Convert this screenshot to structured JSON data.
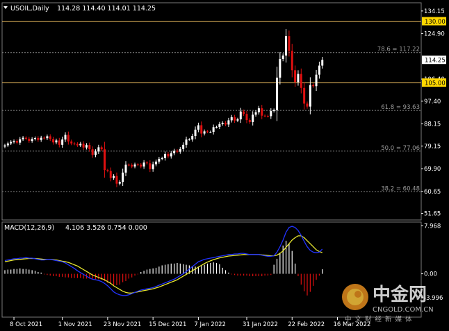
{
  "header": {
    "symbol": "USOIL,Daily",
    "ohlc": "114.28 114.40 114.01 114.25"
  },
  "indicator": {
    "title": "MACD(12,26,9)",
    "values": "4.106 3.526 0.754 0.000"
  },
  "watermark": {
    "brand": "中金网",
    "site": "CNGOLD.COM.CN",
    "tagline": "中文财经新媒体"
  },
  "colors": {
    "background": "#000000",
    "bull_candle": "#ffffff",
    "bear_candle": "#e01010",
    "macd_line": "#2233ff",
    "signal_line": "#e8e830",
    "hist_pos": "#ffffff",
    "hist_neg": "#e01010",
    "level_line": "#f0c060",
    "fib_line": "#8a8a8a",
    "current_price_bg": "#ffffff",
    "level_price_bg": "#ffd700"
  },
  "chart_data": [
    {
      "type": "candlestick",
      "title": "USOIL,Daily",
      "ylim": [
        49.0,
        137.5
      ],
      "yticks": [
        "134.15",
        "124.90",
        "106.40",
        "97.40",
        "88.15",
        "79.15",
        "69.90",
        "60.65",
        "51.65"
      ],
      "x_labels": [
        "8 Oct 2021",
        "1 Nov 2021",
        "23 Nov 2021",
        "15 Dec 2021",
        "7 Jan 2022",
        "31 Jan 2022",
        "22 Feb 2022",
        "16 Mar 2022"
      ],
      "levels": [
        {
          "label": "130.00",
          "value": 130.0
        },
        {
          "label": "105.00",
          "value": 105.0
        }
      ],
      "fib_levels": [
        {
          "label": "78.6 = 117.22",
          "value": 117.22
        },
        {
          "label": "61.8 = 93.63",
          "value": 93.63
        },
        {
          "label": "50.0 = 77.06",
          "value": 77.06
        },
        {
          "label": "38.2 = 60.48",
          "value": 60.48
        }
      ],
      "current_price": {
        "label": "114.25",
        "value": 114.25
      },
      "close": [
        79.4,
        80.2,
        80.8,
        81.2,
        80.5,
        81.9,
        82.5,
        82.1,
        81.2,
        82.0,
        82.4,
        81.6,
        82.5,
        82.3,
        83.1,
        82.0,
        80.6,
        81.4,
        79.6,
        81.8,
        83.7,
        81.0,
        80.2,
        80.0,
        79.4,
        80.1,
        78.5,
        79.5,
        77.8,
        75.5,
        76.9,
        78.6,
        77.8,
        69.3,
        69.0,
        66.1,
        66.9,
        63.8,
        64.5,
        68.3,
        71.5,
        71.4,
        70.8,
        71.6,
        71.5,
        70.8,
        72.4,
        72.1,
        69.7,
        71.7,
        72.8,
        73.9,
        74.2,
        75.9,
        74.9,
        76.2,
        77.2,
        76.8,
        77.9,
        79.6,
        81.8,
        81.8,
        83.2,
        85.8,
        87.6,
        84.2,
        85.1,
        84.9,
        84.9,
        86.8,
        86.9,
        88.1,
        88.6,
        87.9,
        89.6,
        90.9,
        89.5,
        90.0,
        93.2,
        92.2,
        89.7,
        88.9,
        91.9,
        92.9,
        94.5,
        91.5,
        91.4,
        91.3,
        93.4,
        93.8,
        107.0,
        114.6,
        116.0,
        123.9,
        117.9,
        110.0,
        105.2,
        108.5,
        102.8,
        96.4,
        95.2,
        104.0,
        103.5,
        108.2,
        111.9,
        114.25
      ],
      "xtick_index": [
        3,
        19,
        34,
        49,
        64,
        80,
        95,
        110
      ]
    },
    {
      "type": "bar+line",
      "title": "MACD(12,26,9)",
      "ylim": [
        -7.2,
        8.6
      ],
      "yticks": [
        "7.968",
        "0.00",
        "-3.996"
      ],
      "series": [
        {
          "name": "MACD(12,26,9)",
          "values": [
            2.2,
            2.3,
            2.4,
            2.5,
            2.5,
            2.6,
            2.6,
            2.7,
            2.6,
            2.6,
            2.5,
            2.4,
            2.3,
            2.3,
            2.4,
            2.4,
            2.3,
            2.2,
            2.1,
            2.0,
            1.8,
            1.5,
            1.2,
            0.9,
            0.5,
            0.2,
            -0.1,
            -0.4,
            -0.7,
            -0.9,
            -1.0,
            -1.1,
            -1.3,
            -1.6,
            -2.0,
            -2.5,
            -3.0,
            -3.3,
            -3.5,
            -3.6,
            -3.6,
            -3.5,
            -3.3,
            -3.1,
            -2.9,
            -2.7,
            -2.6,
            -2.5,
            -2.4,
            -2.3,
            -2.1,
            -1.9,
            -1.7,
            -1.5,
            -1.3,
            -1.1,
            -0.9,
            -0.6,
            -0.3,
            0.0,
            0.4,
            0.8,
            1.2,
            1.6,
            2.0,
            2.2,
            2.4,
            2.5,
            2.6,
            2.7,
            2.8,
            2.9,
            3.0,
            3.1,
            3.2,
            3.2,
            3.3,
            3.3,
            3.4,
            3.4,
            3.3,
            3.2,
            3.2,
            3.2,
            3.2,
            3.1,
            3.0,
            2.9,
            2.9,
            3.0,
            3.6,
            4.5,
            5.6,
            6.9,
            7.7,
            7.9,
            7.7,
            7.2,
            6.4,
            5.4,
            4.5,
            3.9,
            3.6,
            3.5,
            3.6,
            4.106
          ]
        },
        {
          "name": "Signal",
          "values": [
            2.0,
            2.1,
            2.2,
            2.3,
            2.35,
            2.4,
            2.45,
            2.5,
            2.55,
            2.55,
            2.55,
            2.5,
            2.45,
            2.4,
            2.4,
            2.4,
            2.35,
            2.3,
            2.2,
            2.1,
            2.0,
            1.9,
            1.7,
            1.5,
            1.3,
            1.0,
            0.7,
            0.4,
            0.1,
            -0.2,
            -0.4,
            -0.6,
            -0.8,
            -1.0,
            -1.3,
            -1.6,
            -2.0,
            -2.3,
            -2.6,
            -2.9,
            -3.1,
            -3.2,
            -3.2,
            -3.1,
            -3.0,
            -2.9,
            -2.8,
            -2.7,
            -2.6,
            -2.5,
            -2.35,
            -2.2,
            -2.0,
            -1.8,
            -1.6,
            -1.4,
            -1.2,
            -1.0,
            -0.7,
            -0.4,
            -0.1,
            0.2,
            0.5,
            0.8,
            1.1,
            1.4,
            1.7,
            1.95,
            2.15,
            2.35,
            2.5,
            2.65,
            2.75,
            2.85,
            2.95,
            3.0,
            3.05,
            3.1,
            3.15,
            3.2,
            3.2,
            3.2,
            3.2,
            3.2,
            3.2,
            3.15,
            3.1,
            3.05,
            3.0,
            3.0,
            3.1,
            3.4,
            3.8,
            4.4,
            5.0,
            5.6,
            6.0,
            6.3,
            6.3,
            6.0,
            5.5,
            5.0,
            4.5,
            4.0,
            3.7,
            3.526
          ]
        },
        {
          "name": "Histogram",
          "values": [
            0.6,
            0.7,
            0.7,
            0.8,
            0.8,
            0.9,
            0.8,
            0.8,
            0.7,
            0.6,
            0.5,
            0.3,
            0.2,
            -0.1,
            -0.2,
            -0.3,
            -0.4,
            -0.4,
            -0.5,
            -0.5,
            -0.6,
            -0.6,
            -0.7,
            -0.7,
            -0.7,
            -0.7,
            -0.8,
            -0.8,
            -0.8,
            -0.8,
            -0.9,
            -0.9,
            -1.0,
            -1.2,
            -1.5,
            -1.7,
            -1.9,
            -1.9,
            -1.8,
            -1.4,
            -1.2,
            -0.8,
            -0.6,
            -0.3,
            -0.1,
            0.3,
            0.5,
            0.7,
            0.8,
            0.9,
            1.0,
            1.2,
            1.4,
            1.5,
            1.6,
            1.7,
            1.7,
            1.8,
            1.7,
            1.6,
            1.5,
            1.4,
            1.3,
            1.2,
            1.2,
            1.3,
            1.5,
            1.7,
            1.8,
            1.9,
            1.8,
            1.6,
            1.0,
            0.6,
            0.2,
            -0.1,
            -0.2,
            -0.3,
            -0.3,
            -0.3,
            -0.3,
            -0.4,
            -0.4,
            -0.4,
            -0.4,
            -0.4,
            -0.3,
            -0.3,
            -0.2,
            1.5,
            2.5,
            3.5,
            4.7,
            5.5,
            5.0,
            3.8,
            1.7,
            -0.4,
            -1.8,
            -2.9,
            -3.6,
            -3.0,
            -2.0,
            -1.0,
            -0.3,
            0.754
          ]
        }
      ]
    }
  ]
}
